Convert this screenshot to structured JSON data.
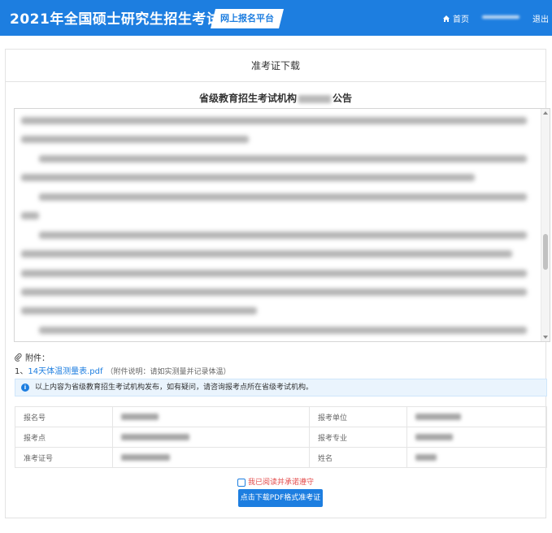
{
  "header": {
    "title": "2021年全国硕士研究生招生考试",
    "platform": "网上报名平台",
    "home_label": "首页",
    "logout_label": "退出"
  },
  "tab": {
    "label": "准考证下载"
  },
  "notice": {
    "title_prefix": "省级教育招生考试机构",
    "title_suffix": "公告"
  },
  "attachment": {
    "heading": "附件：",
    "index": "1、",
    "file_name": "14天体温测量表.pdf",
    "file_note": "（附件说明：请如实测量并记录体温）"
  },
  "info_text": "以上内容为省级教育招生考试机构发布，如有疑问，请咨询报考点所在省级考试机构。",
  "table": {
    "rows": [
      [
        "报名号",
        "报考单位"
      ],
      [
        "报考点",
        "报考专业"
      ],
      [
        "准考证号",
        "姓名"
      ]
    ]
  },
  "agree_label": "我已阅读并承诺遵守",
  "download_button": "点击下载PDF格式准考证",
  "colors": {
    "primary": "#1d7ee0",
    "warn": "#e34a4a"
  }
}
